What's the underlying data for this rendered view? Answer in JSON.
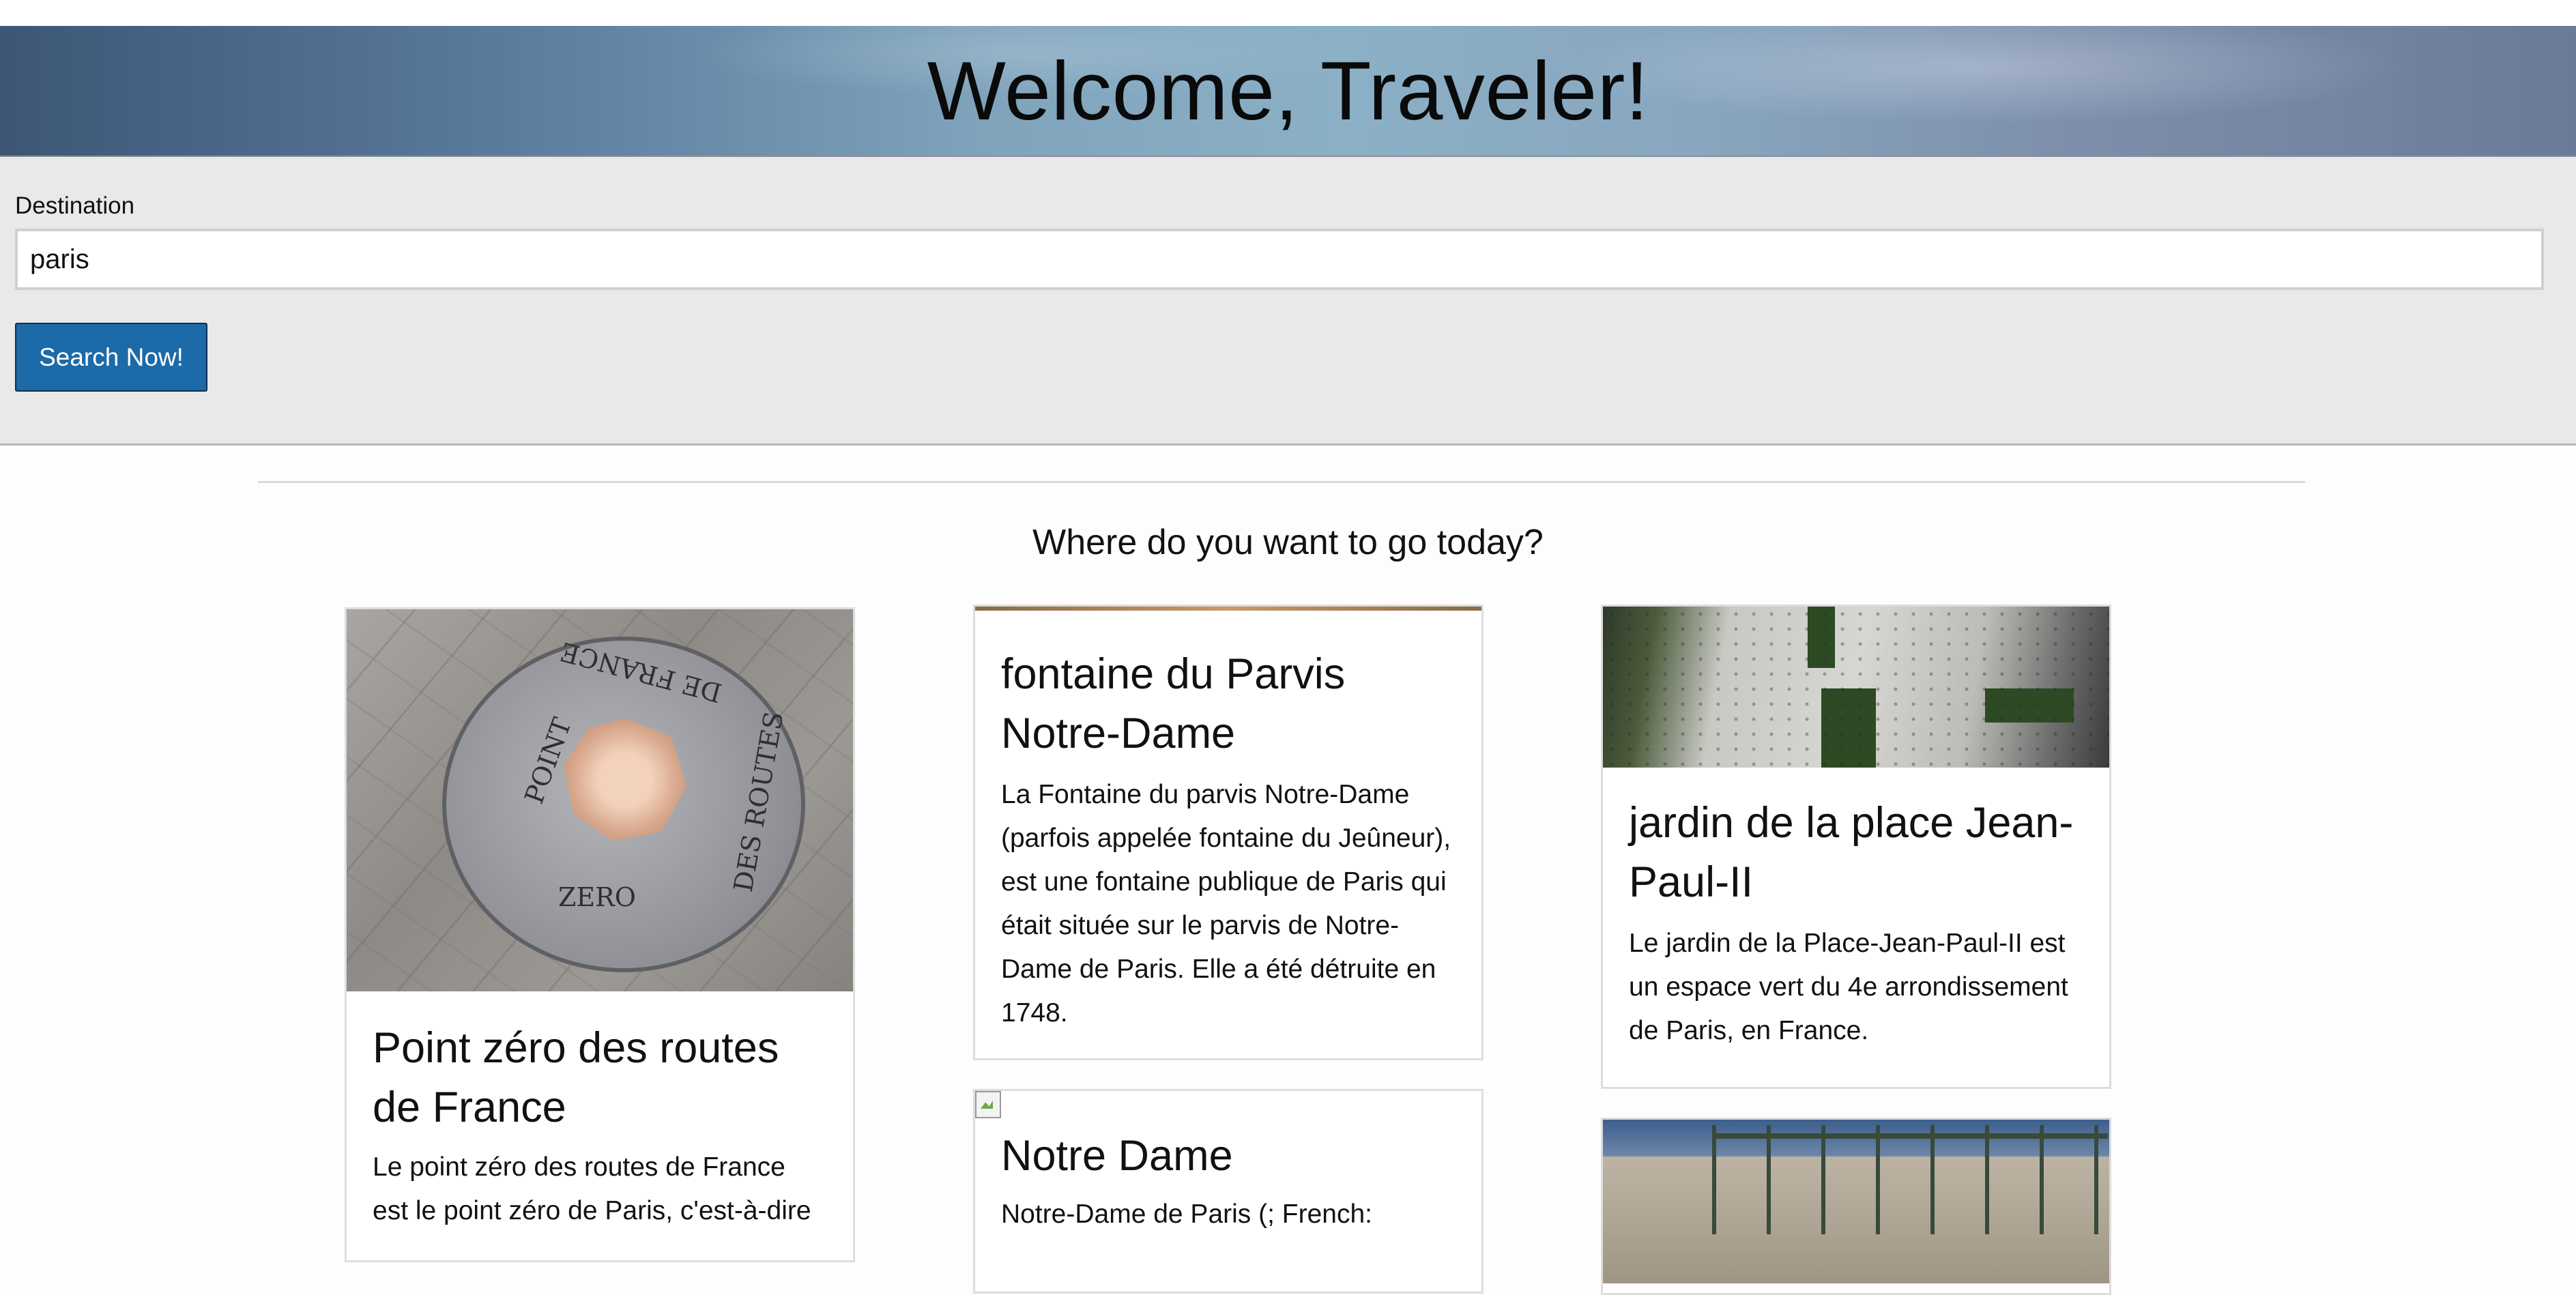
{
  "header": {
    "title": "Welcome, Traveler!"
  },
  "search": {
    "label": "Destination",
    "value": "paris",
    "button_label": "Search Now!"
  },
  "results": {
    "heading": "Where do you want to go today?",
    "cards": [
      {
        "title": "Point zéro des routes de France",
        "text": "Le point zéro des routes de France est le point zéro de Paris, c'est-à-dire",
        "image_words": [
          "POINT",
          "ZERO",
          "DE FRANCE",
          "DES ROUTES"
        ]
      },
      {
        "title": "fontaine du Parvis Notre-Dame",
        "text": "La Fontaine du parvis Notre-Dame (parfois appelée fontaine du Jeûneur), est une fontaine publique de Paris qui était située sur le parvis de Notre-Dame de Paris. Elle a été détruite en 1748."
      },
      {
        "title": "jardin de la place Jean-Paul-II",
        "text": "Le jardin de la Place-Jean-Paul-II est un espace vert du 4e arrondissement de Paris, en France."
      },
      {
        "title": "Notre Dame",
        "text": "Notre-Dame de Paris (; French:"
      }
    ]
  },
  "colors": {
    "button": "#1c6aa8",
    "panel": "#e9e9e9"
  }
}
